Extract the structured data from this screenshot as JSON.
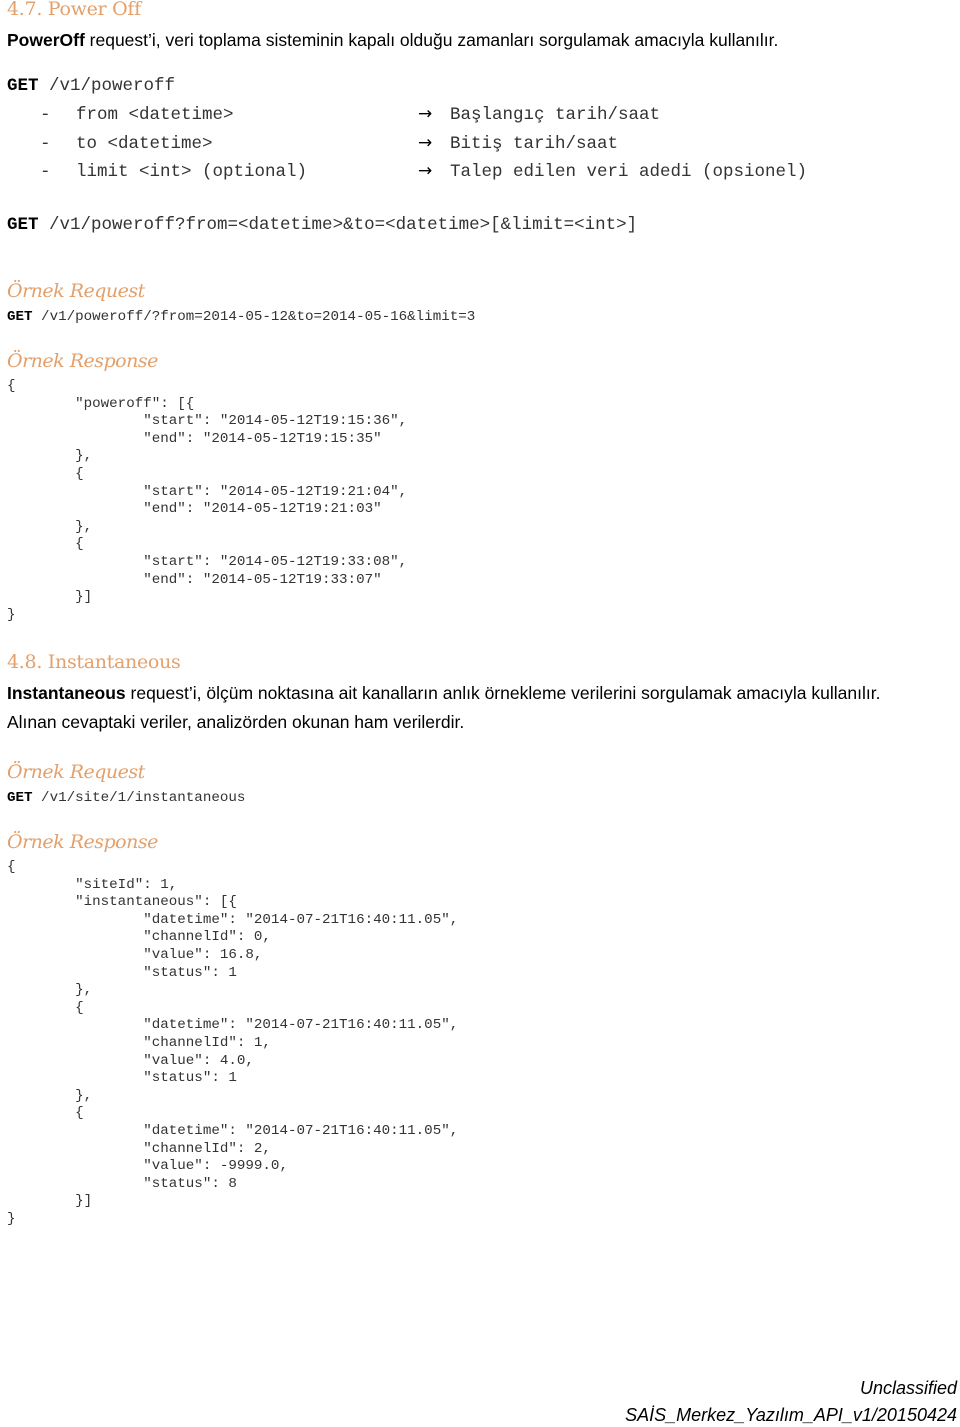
{
  "section_47": {
    "heading": "4.7. Power Off",
    "intro_bold": "PowerOff",
    "intro_rest": " request’i, veri toplama sisteminin kapalı olduğu zamanları sorgulamak amacıyla kullanılır.",
    "endpoint_method": "GET",
    "endpoint_path": " /v1/poweroff",
    "params": [
      {
        "bullet": "-",
        "name": "from <datetime>",
        "arrow_icon": "right-arrow-icon",
        "description": "Başlangıç tarih/saat"
      },
      {
        "bullet": "-",
        "name": "to <datetime>",
        "arrow_icon": "right-arrow-icon",
        "description": "Bitiş tarih/saat"
      },
      {
        "bullet": "-",
        "name": "limit <int> (optional)",
        "arrow_icon": "right-arrow-icon",
        "description": "Talep edilen veri adedi (opsionel)"
      }
    ],
    "query_method": "GET",
    "query_path": " /v1/poweroff?from=<datetime>&to=<datetime>[&limit=<int>]",
    "example_request_title": "Örnek Request",
    "example_request_method": "GET",
    "example_request_path": " /v1/poweroff/?from=2014-05-12&to=2014-05-16&limit=3",
    "example_response_title": "Örnek Response",
    "response_lines": [
      "{",
      "        \"poweroff\": [{",
      "                \"start\": \"2014-05-12T19:15:36\",",
      "                \"end\": \"2014-05-12T19:15:35\"",
      "        },",
      "        {",
      "                \"start\": \"2014-05-12T19:21:04\",",
      "                \"end\": \"2014-05-12T19:21:03\"",
      "        },",
      "        {",
      "                \"start\": \"2014-05-12T19:33:08\",",
      "                \"end\": \"2014-05-12T19:33:07\"",
      "        }]",
      "}"
    ]
  },
  "section_48": {
    "heading": "4.8. Instantaneous",
    "intro_bold": "Instantaneous",
    "intro_rest": " request’i, ölçüm noktasına ait kanalların anlık örnekleme verilerini sorgulamak amacıyla kullanılır.",
    "intro_line2": "Alınan cevaptaki veriler, analizörden okunan ham verilerdir.",
    "example_request_title": "Örnek Request",
    "example_request_method": "GET",
    "example_request_path": " /v1/site/1/instantaneous",
    "example_response_title": "Örnek Response",
    "response_lines": [
      "{",
      "        \"siteId\": 1,",
      "        \"instantaneous\": [{",
      "                \"datetime\": \"2014-07-21T16:40:11.05\",",
      "                \"channelId\": 0,",
      "                \"value\": 16.8,",
      "                \"status\": 1",
      "        },",
      "        {",
      "                \"datetime\": \"2014-07-21T16:40:11.05\",",
      "                \"channelId\": 1,",
      "                \"value\": 4.0,",
      "                \"status\": 1",
      "        },",
      "        {",
      "                \"datetime\": \"2014-07-21T16:40:11.05\",",
      "                \"channelId\": 2,",
      "                \"value\": -9999.0,",
      "                \"status\": 8",
      "        }]",
      "}"
    ]
  },
  "footer": {
    "classification": "Unclassified",
    "document_id": "SAİS_Merkez_Yazılım_API_v1/20150424"
  },
  "colors": {
    "heading": "#E3A06B",
    "body_text": "#000000",
    "code_text": "#333333"
  }
}
